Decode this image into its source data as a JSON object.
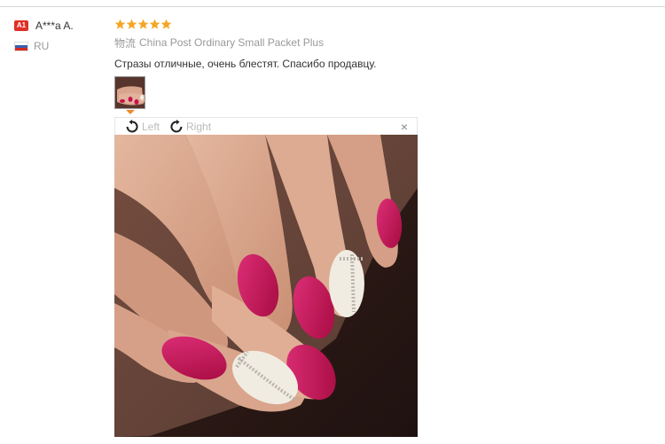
{
  "buyer": {
    "level_badge": "A1",
    "name": "A***a A.",
    "country": "RU"
  },
  "review": {
    "rating": 5,
    "rating_max": 5,
    "star_color": "#f5a623",
    "shipping_label": "物流",
    "shipping_method": "China Post Ordinary Small Packet Plus",
    "text": "Стразы отличные, очень блестят. Спасибо продавцу."
  },
  "viewer": {
    "rotate_left_label": "Left",
    "rotate_right_label": "Right",
    "close_label": "×"
  },
  "colors": {
    "badge_red": "#e02f27",
    "accent_orange": "#f0892c",
    "nail_pink": "#c8124e"
  }
}
